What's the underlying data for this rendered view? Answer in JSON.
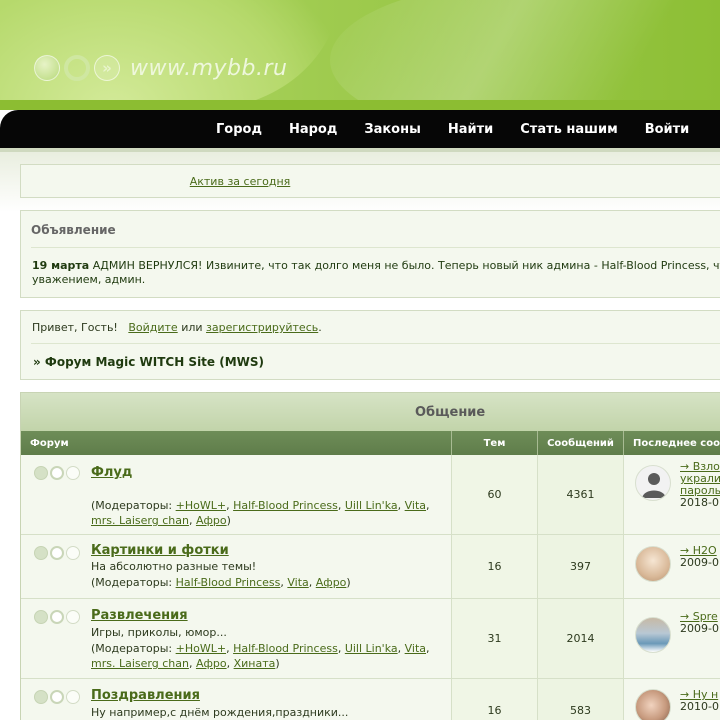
{
  "header": {
    "logo_text": "www.mybb.ru"
  },
  "nav": {
    "items": [
      "Город",
      "Народ",
      "Законы",
      "Найти",
      "Стать нашим",
      "Войти"
    ]
  },
  "active": {
    "link": "Актив за сегодня"
  },
  "announcement": {
    "title": "Объявление",
    "date": "19 марта",
    "line1": " АДМИН ВЕРНУЛСЯ! Извините, что так долго меня не было. Теперь новый ник админа - Half-Blood Princess, чт",
    "line2": "уважением, админ."
  },
  "welcome": {
    "greeting": "Привет, Гость!",
    "login": "Войдите",
    "or": " или ",
    "register": "зарегистрируйтесь",
    "dot": ".",
    "breadcrumb": "» Форум Magic WITCH Site (MWS)"
  },
  "forum": {
    "category": "Общение",
    "columns": {
      "forum": "Форум",
      "topics": "Тем",
      "posts": "Сообщений",
      "last": "Последнее соо"
    },
    "rows": [
      {
        "title": "Флуд",
        "desc": "",
        "mods_prefix": "(Модераторы: ",
        "mods": [
          "+HoWL+",
          "Half-Blood Princess",
          "Uill Lin'ka",
          "Vita",
          "mrs. Laiserg chan",
          "Афро"
        ],
        "mods_suffix": ")",
        "topics": "60",
        "posts": "4361",
        "last_lines": [
          "→ Взло",
          "украли",
          "пароль"
        ],
        "last_date": "2018-0"
      },
      {
        "title": "Картинки и фотки",
        "desc": "На абсолютно разные темы!",
        "mods_prefix": "(Модераторы: ",
        "mods": [
          "Half-Blood Princess",
          "Vita",
          "Афро"
        ],
        "mods_suffix": ")",
        "topics": "16",
        "posts": "397",
        "last_lines": [
          "→ H2O"
        ],
        "last_date": "2009-0"
      },
      {
        "title": "Развлечения",
        "desc": "Игры, приколы, юмор...",
        "mods_prefix": "(Модераторы: ",
        "mods": [
          "+HoWL+",
          "Half-Blood Princess",
          "Uill Lin'ka",
          "Vita",
          "mrs. Laiserg chan",
          "Афро",
          "Хината"
        ],
        "mods_suffix": ")",
        "topics": "31",
        "posts": "2014",
        "last_lines": [
          "→ Spre"
        ],
        "last_date": "2009-0"
      },
      {
        "title": "Поздравления",
        "desc": "Ну например,с днём рождения,праздники...",
        "mods_prefix": "",
        "mods": [],
        "mods_suffix": "",
        "topics": "16",
        "posts": "583",
        "last_lines": [
          "→ Ну н"
        ],
        "last_date": "2010-0"
      }
    ]
  },
  "colors": {
    "accent": "#4a6b1a",
    "nav_bg": "#060606",
    "header_green": "#9fcb4f",
    "column_header": "#6e8d58"
  }
}
